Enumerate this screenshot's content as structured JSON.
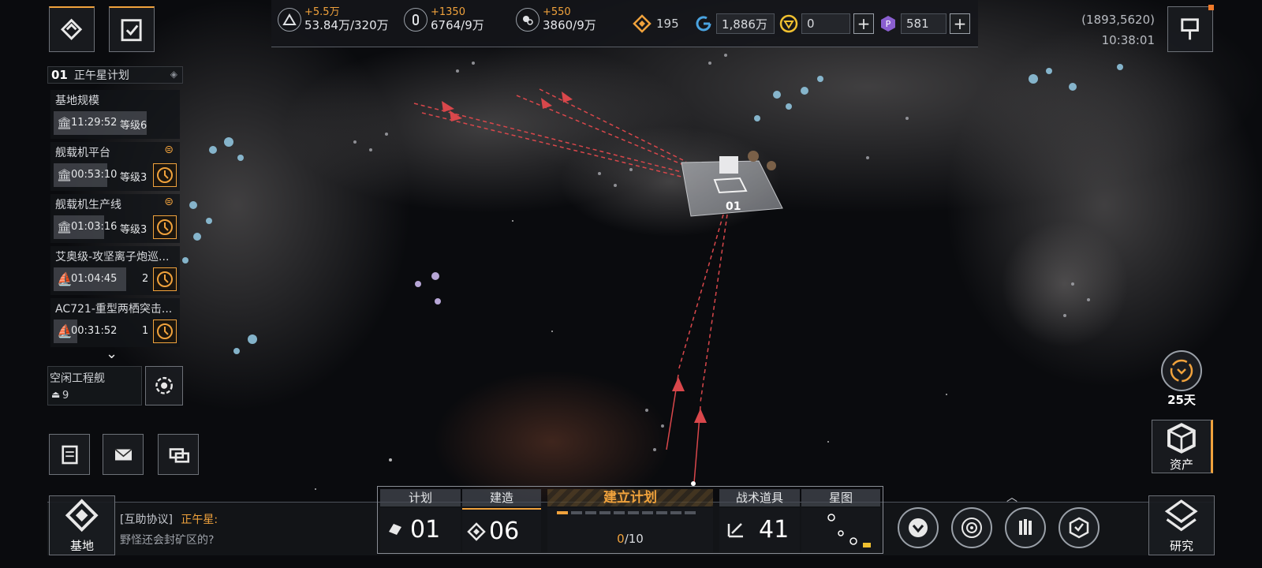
{
  "top": {
    "res1": {
      "delta": "+5.5万",
      "amount": "53.84万/320万"
    },
    "res2": {
      "delta": "+1350",
      "amount": "6764/9万"
    },
    "res3": {
      "delta": "+550",
      "amount": "3860/9万"
    },
    "cur1": "195",
    "cur2": "1,886万",
    "cur3": "0",
    "cur4": "581",
    "coords": "(1893,5620)",
    "time": "10:38:01"
  },
  "plan": {
    "num": "01",
    "name": "正午星计划"
  },
  "queue": [
    {
      "title": "基地规模",
      "time": "11:29:52",
      "level": "等级6"
    },
    {
      "title": "舰载机平台",
      "time": "00:53:10",
      "level": "等级3"
    },
    {
      "title": "舰载机生产线",
      "time": "01:03:16",
      "level": "等级3"
    },
    {
      "title": "艾奥级-攻坚离子炮巡...",
      "time": "01:04:45",
      "level": "2"
    },
    {
      "title": "AC721-重型两栖突击...",
      "time": "00:31:52",
      "level": "1"
    }
  ],
  "idle": {
    "label": "空闲工程舰",
    "count": "9"
  },
  "map": {
    "base_label": "01"
  },
  "right": {
    "days": "25天",
    "assets": "资产",
    "research": "研究"
  },
  "bottom": {
    "base": "基地",
    "chat_channel": "[互助协议]",
    "chat_user": "正午星:",
    "chat_msg": "野怪还会封矿区的?",
    "tab_plan": "计划",
    "plan_val": "01",
    "tab_build": "建造",
    "build_val": "06",
    "tab_establish": "建立计划",
    "establish_cur": "0",
    "establish_total": "/10",
    "tab_items": "战术道具",
    "items_val": "41",
    "tab_starmap": "星图"
  },
  "colors": {
    "accent": "#f0a23c",
    "route": "#d9474b",
    "panel": "#16181c"
  }
}
